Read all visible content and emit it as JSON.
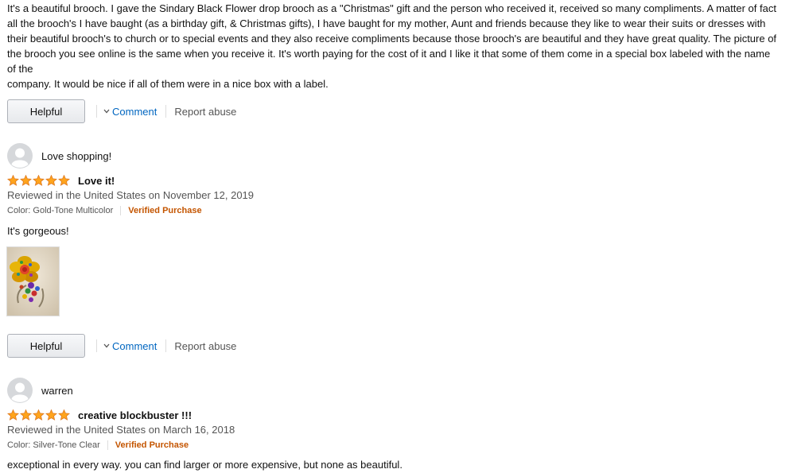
{
  "top_review": {
    "text_lines": [
      "It's a beautiful brooch. I gave the Sindary Black Flower drop brooch as a \"Christmas\" gift and the person who received it, received so many compliments. A matter of fact",
      "all the brooch's I have baught (as a birthday gift, & Christmas gifts), I have baught for my mother, Aunt and friends because they like to wear their suits or dresses with",
      "their beautiful brooch's to church or to special events and they also receive compliments because those brooch's are beautiful and they have great quality. The picture of",
      "the brooch you see online is the same when you receive it. It's worth paying for the cost of it and I like it that some of them come in a special box labeled with the name",
      "of the",
      "company. It would be nice if all of them were in a nice box with a label."
    ]
  },
  "actions": {
    "helpful_label": "Helpful",
    "comment_label": "Comment",
    "report_label": "Report abuse"
  },
  "reviews": [
    {
      "reviewer": "Love shopping!",
      "rating": 5,
      "title": "Love it!",
      "date": "Reviewed in the United States on November 12, 2019",
      "variant": "Color: Gold-Tone Multicolor",
      "verified": "Verified Purchase",
      "body": "It's gorgeous!",
      "has_image": true
    },
    {
      "reviewer": "warren",
      "rating": 5,
      "title": "creative blockbuster !!!",
      "date": "Reviewed in the United States on March 16, 2018",
      "variant": "Color: Silver-Tone Clear",
      "verified": "Verified Purchase",
      "body": "exceptional in every way. you can find larger or more expensive, but none as beautiful.",
      "has_image": false
    }
  ],
  "colors": {
    "link": "#0066c0",
    "verified": "#c45500",
    "star": "#ffa41c",
    "muted": "#555555"
  },
  "icons": {
    "avatar": "default-avatar-icon",
    "star": "star-icon",
    "chevron": "chevron-down-icon"
  }
}
